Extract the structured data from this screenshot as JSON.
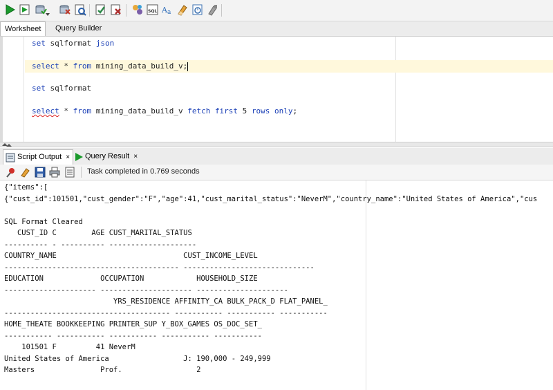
{
  "toolbar": {
    "buttons": [
      {
        "name": "run-statement-icon",
        "color": "#1b9a2c"
      },
      {
        "name": "run-script-icon",
        "color": "#3a7d3a"
      },
      {
        "name": "commit-icon",
        "color": "#8a6b2f"
      },
      {
        "name": "rollback-icon",
        "color": "#c0392b"
      },
      {
        "name": "explain-plan-icon",
        "color": "#4a6fa5"
      },
      {
        "name": "autotrace-icon",
        "color": "#2f8a4a"
      },
      {
        "name": "clear-icon",
        "color": "#b03030"
      },
      {
        "name": "sql-tuning-icon",
        "color": "#7a5ea8"
      },
      {
        "name": "sql-format-icon",
        "color": "#555555"
      },
      {
        "name": "to-upper-icon",
        "color": "#2a6ab8"
      },
      {
        "name": "eraser-icon",
        "color": "#d98c1f"
      },
      {
        "name": "history-icon",
        "color": "#3a6fb0"
      },
      {
        "name": "highlight-icon",
        "color": "#888888"
      }
    ],
    "sql_label": "SQL",
    "ab_label": "Aá"
  },
  "worksheet_tabs": {
    "worksheet": "Worksheet",
    "query_builder": "Query Builder"
  },
  "editor": {
    "line1": {
      "kw": "set",
      "rest": " sqlformat ",
      "kw2": "json"
    },
    "line2": {
      "kw": "select",
      "mid": " * ",
      "kw2": "from",
      "rest": " mining_data_build_v;"
    },
    "line3": {
      "kw": "set",
      "rest": " sqlformat"
    },
    "line4": {
      "kw": "select",
      "mid": " * ",
      "kw2": "from",
      "rest": " mining_data_build_v ",
      "kw3": "fetch first",
      "num": " 5 ",
      "kw4": "rows only",
      "end": ";"
    }
  },
  "output_tabs": {
    "script_output": "Script Output",
    "query_result": "Query Result",
    "close": "×"
  },
  "output_toolbar": {
    "status": "Task completed in 0.769 seconds"
  },
  "output_lines": [
    "{\"items\":[",
    "{\"cust_id\":101501,\"cust_gender\":\"F\",\"age\":41,\"cust_marital_status\":\"NeverM\",\"country_name\":\"United States of America\",\"cus",
    "",
    "SQL Format Cleared",
    "   CUST_ID C        AGE CUST_MARITAL_STATUS",
    "---------- - ---------- --------------------",
    "COUNTRY_NAME                             CUST_INCOME_LEVEL",
    "---------------------------------------- ------------------------------",
    "EDUCATION             OCCUPATION            HOUSEHOLD_SIZE",
    "--------------------- --------------------- ---------------------",
    "                         YRS_RESIDENCE AFFINITY_CA BULK_PACK_D FLAT_PANEL_",
    "-------------------------------------- ----------- ----------- -----------",
    "HOME_THEATE BOOKKEEPING PRINTER_SUP Y_BOX_GAMES OS_DOC_SET_",
    "----------- ----------- ----------- ----------- -----------",
    "    101501 F         41 NeverM",
    "United States of America                 J: 190,000 - 249,999",
    "Masters               Prof.                 2"
  ]
}
